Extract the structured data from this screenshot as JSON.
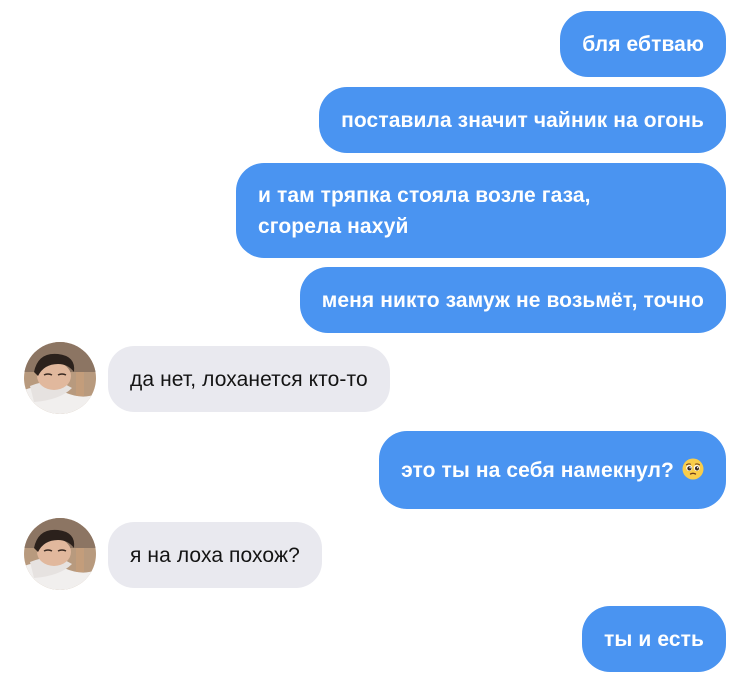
{
  "conversation": {
    "messages": [
      {
        "direction": "outgoing",
        "text": "бля ебтваю"
      },
      {
        "direction": "outgoing",
        "text": "поставила значит чайник на огонь"
      },
      {
        "direction": "outgoing",
        "text": "и там тряпка стояла возле газа,\nсгорела нахуй"
      },
      {
        "direction": "outgoing",
        "text": "меня никто замуж не возьмёт, точно"
      },
      {
        "direction": "incoming",
        "text": "да нет, лоханется кто-то"
      },
      {
        "direction": "outgoing",
        "text": "это ты на себя намекнул?",
        "emoji": "pleading-face-emoji"
      },
      {
        "direction": "incoming",
        "text": "я на лоха похож?"
      },
      {
        "direction": "outgoing",
        "text": "ты и есть"
      }
    ]
  },
  "colors": {
    "outgoing_bubble": "#4a94f1",
    "incoming_bubble": "#e9e9ef",
    "outgoing_text": "#ffffff",
    "incoming_text": "#141414"
  },
  "icons": {
    "avatar": "avatar-photo",
    "emoji": "pleading-face-emoji"
  }
}
